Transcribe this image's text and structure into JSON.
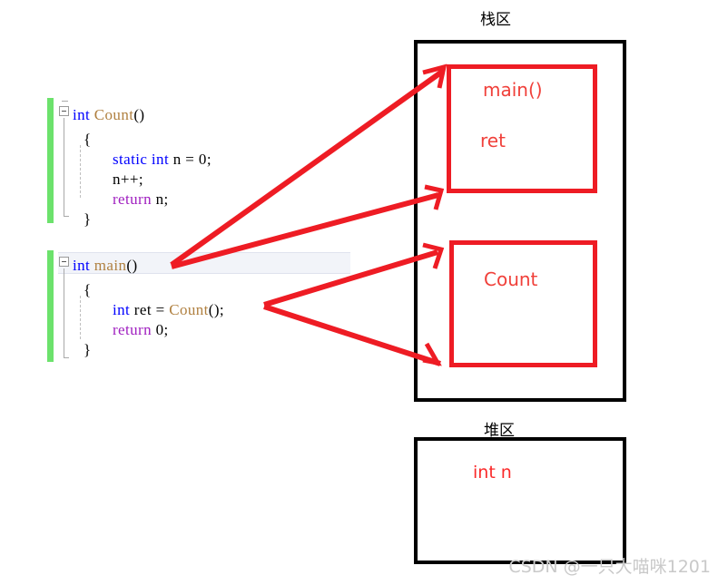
{
  "code": {
    "lines": [
      {
        "indent": 0,
        "tokens": [
          {
            "t": "int ",
            "c": "kw"
          },
          {
            "t": "Count",
            "c": "fn"
          },
          {
            "t": "()",
            "c": "pl"
          }
        ]
      },
      {
        "indent": 1,
        "tokens": [
          {
            "t": "{",
            "c": "brace"
          }
        ]
      },
      {
        "indent": 2,
        "tokens": [
          {
            "t": "static int",
            "c": "kw"
          },
          {
            "t": " n = 0;",
            "c": "pl"
          }
        ]
      },
      {
        "indent": 2,
        "tokens": [
          {
            "t": "n++;",
            "c": "pl"
          }
        ]
      },
      {
        "indent": 2,
        "tokens": [
          {
            "t": "return",
            "c": "ctl"
          },
          {
            "t": " n;",
            "c": "pl"
          }
        ]
      },
      {
        "indent": 1,
        "tokens": [
          {
            "t": "}",
            "c": "brace"
          }
        ]
      },
      {
        "indent": 0,
        "tokens": [
          {
            "t": "int ",
            "c": "kw"
          },
          {
            "t": "main",
            "c": "fn"
          },
          {
            "t": "()",
            "c": "pl"
          }
        ]
      },
      {
        "indent": 1,
        "tokens": [
          {
            "t": "{",
            "c": "brace"
          }
        ]
      },
      {
        "indent": 2,
        "tokens": [
          {
            "t": "int",
            "c": "kw"
          },
          {
            "t": " ret = ",
            "c": "pl"
          },
          {
            "t": "Count",
            "c": "fn"
          },
          {
            "t": "();",
            "c": "pl"
          }
        ]
      },
      {
        "indent": 2,
        "tokens": [
          {
            "t": "return",
            "c": "ctl"
          },
          {
            "t": " 0;",
            "c": "pl"
          }
        ]
      },
      {
        "indent": 1,
        "tokens": [
          {
            "t": "}",
            "c": "brace"
          }
        ]
      }
    ],
    "plain_text": "int Count()\n{\n    static int n = 0;\n    n++;\n    return n;\n}\n\nint main()\n{\n    int ret = Count();\n    return 0;\n}"
  },
  "diagram": {
    "stack": {
      "title": "栈区",
      "frames": [
        {
          "name": "main-frame",
          "labels": [
            "main()",
            "ret"
          ]
        },
        {
          "name": "count-frame",
          "labels": [
            "Count"
          ]
        }
      ]
    },
    "heap": {
      "title": "堆区",
      "labels": [
        "int n"
      ]
    }
  },
  "colors": {
    "keyword": "#0000ff",
    "control": "#a020c0",
    "function": "#b08040",
    "arrow_red": "#ee1c24",
    "inner_box_red": "#ee1c24",
    "outer_box_black": "#000000",
    "change_bar_green": "#6ce26c",
    "watermark_gray": "#c9c9c9"
  },
  "watermark": "CSDN @一只大喵咪1201"
}
